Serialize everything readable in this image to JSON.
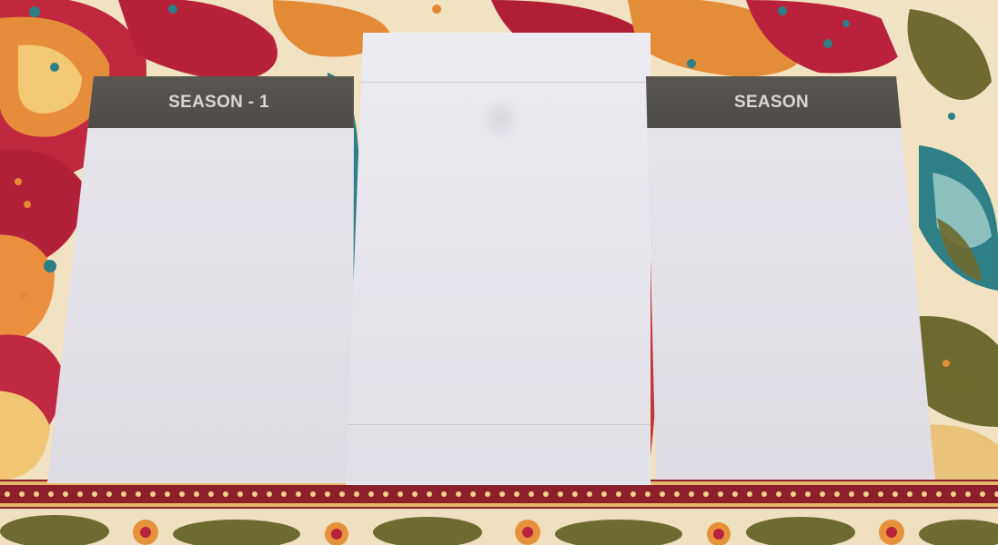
{
  "scene": {
    "description_colors": {
      "cloth_background": "#f1e2c2",
      "paisley_red": "#b3203a",
      "paisley_orange": "#e8903a",
      "paisley_teal": "#2f7f86",
      "paisley_olive": "#6e6a2e",
      "border_red": "#8f1e2c",
      "card_white": "#e5e2ea",
      "header_gray": "#534f4a",
      "header_text": "#d9d6d2"
    }
  },
  "cards": {
    "left": {
      "header": "SEASON - 1"
    },
    "center": {
      "header": ""
    },
    "right": {
      "header": "SEASON"
    }
  }
}
